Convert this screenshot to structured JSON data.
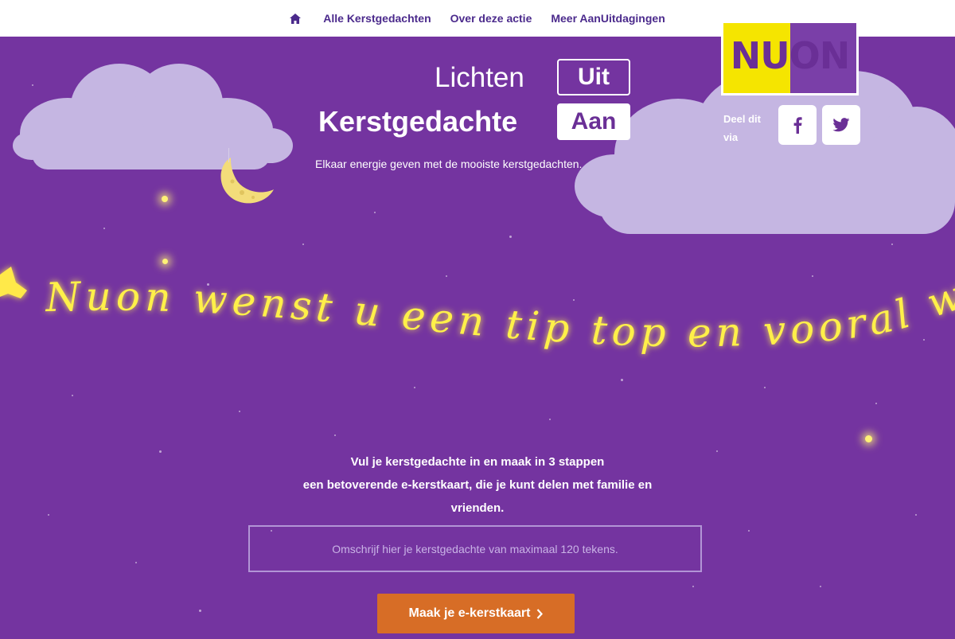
{
  "nav": {
    "home_icon": "home-icon",
    "items": [
      {
        "label": "Alle Kerstgedachten"
      },
      {
        "label": "Over deze actie"
      },
      {
        "label": "Meer AanUitdagingen"
      }
    ]
  },
  "logo": {
    "text": "NUON"
  },
  "share": {
    "label": "Deel dit via",
    "facebook_icon": "facebook-icon",
    "twitter_icon": "twitter-icon"
  },
  "hero": {
    "title_line1": "Lichten",
    "title_line2": "Kerstgedachte",
    "toggle_uit": "Uit",
    "toggle_aan": "Aan",
    "tagline": "Elkaar energie geven met de mooiste kerstgedachten."
  },
  "banner": {
    "text": "Nuon wenst u een tip top en vooral w"
  },
  "intro": {
    "line1": "Vul je kerstgedachte in en maak in 3 stappen",
    "line2": "een betoverende e-kerstkaart, die je kunt delen met familie en",
    "line3": "vrienden."
  },
  "form": {
    "placeholder": "Omschrijf hier je kerstgedachte van maximaal 120 tekens.",
    "cta_label": "Maak je e-kerstkaart"
  },
  "colors": {
    "background": "#7434a0",
    "nav_text": "#4b2a8c",
    "cta": "#d76d26",
    "logo_yellow": "#f5e500",
    "logo_purple": "#7a3fa8",
    "glow_text": "#fff04a"
  }
}
